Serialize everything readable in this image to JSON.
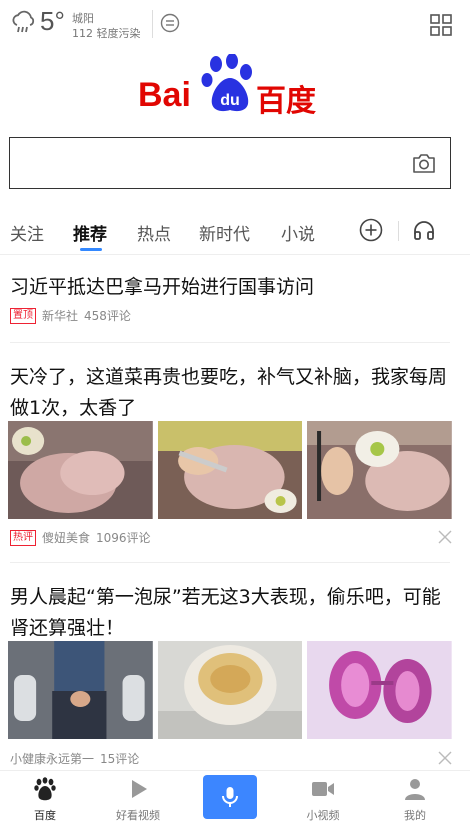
{
  "status": {
    "temperature": "5°",
    "city": "城阳",
    "aqi": "112 轻度污染"
  },
  "logo": {
    "text_left": "Bai",
    "paw_text": "du",
    "text_right": "百度"
  },
  "search": {
    "placeholder": ""
  },
  "tabs": [
    "关注",
    "推荐",
    "热点",
    "新时代",
    "小说"
  ],
  "active_tab": "推荐",
  "feed": [
    {
      "title": "习近平抵达巴拿马开始进行国事访问",
      "tag": "置顶",
      "source": "新华社",
      "comments": "458评论"
    },
    {
      "title": "天冷了，这道菜再贵也要吃，补气又补脑，我家每周做1次，太香了",
      "tag": "热评",
      "source": "傻妞美食",
      "comments": "1096评论"
    },
    {
      "title": "男人晨起“第一泡尿”若无这3大表现，偷乐吧，可能肾还算强壮！",
      "source": "小健康永远第一",
      "comments": "15评论"
    }
  ],
  "bottom_nav": [
    {
      "label": "百度",
      "icon": "paw-icon"
    },
    {
      "label": "好看视频",
      "icon": "play-icon"
    },
    {
      "label": "",
      "icon": "mic-icon"
    },
    {
      "label": "小视频",
      "icon": "video-camera-icon"
    },
    {
      "label": "我的",
      "icon": "person-icon"
    }
  ],
  "colors": {
    "brand_red": "#e10602",
    "brand_blue": "#2932e1",
    "tab_underline": "#3388ff",
    "mic_button": "#3c86ff"
  }
}
